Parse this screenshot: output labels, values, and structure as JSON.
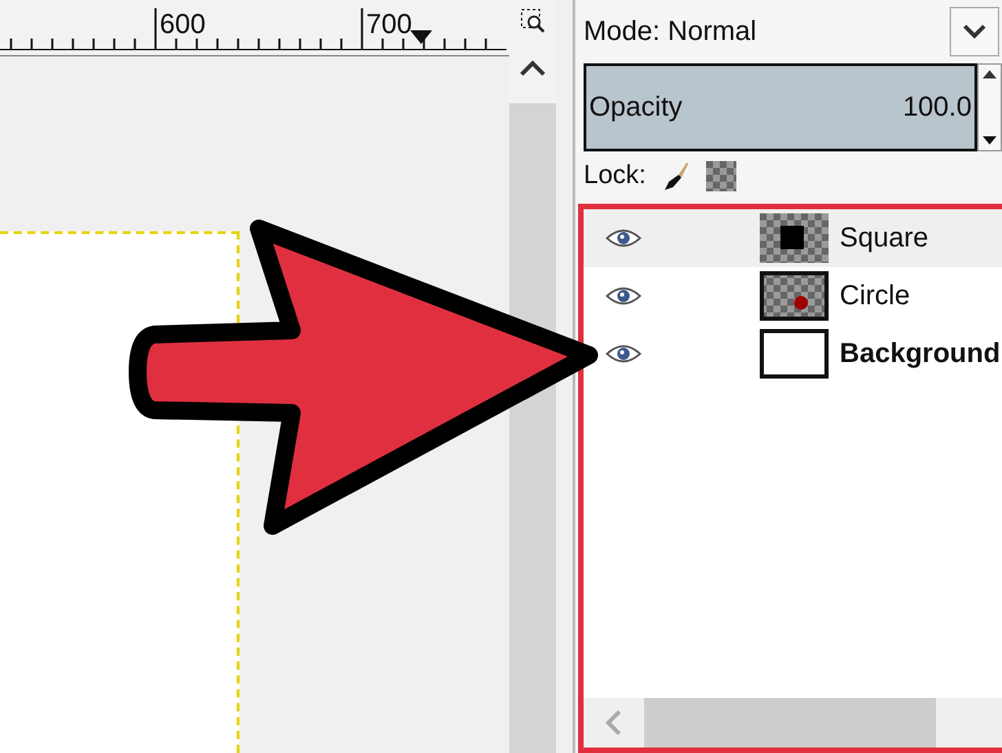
{
  "ruler": {
    "labels": [
      "600",
      "700"
    ]
  },
  "mode": {
    "label": "Mode: Normal"
  },
  "opacity": {
    "label": "Opacity",
    "value": "100.0",
    "level": 1.0
  },
  "lock": {
    "label": "Lock:"
  },
  "layers": [
    {
      "name": "Square",
      "visible": true,
      "selected": true,
      "kind": "square",
      "has_alpha": true
    },
    {
      "name": "Circle",
      "visible": true,
      "selected": false,
      "kind": "circle",
      "has_alpha": true
    },
    {
      "name": "Background",
      "visible": true,
      "selected": false,
      "kind": "blank",
      "has_alpha": false
    }
  ]
}
